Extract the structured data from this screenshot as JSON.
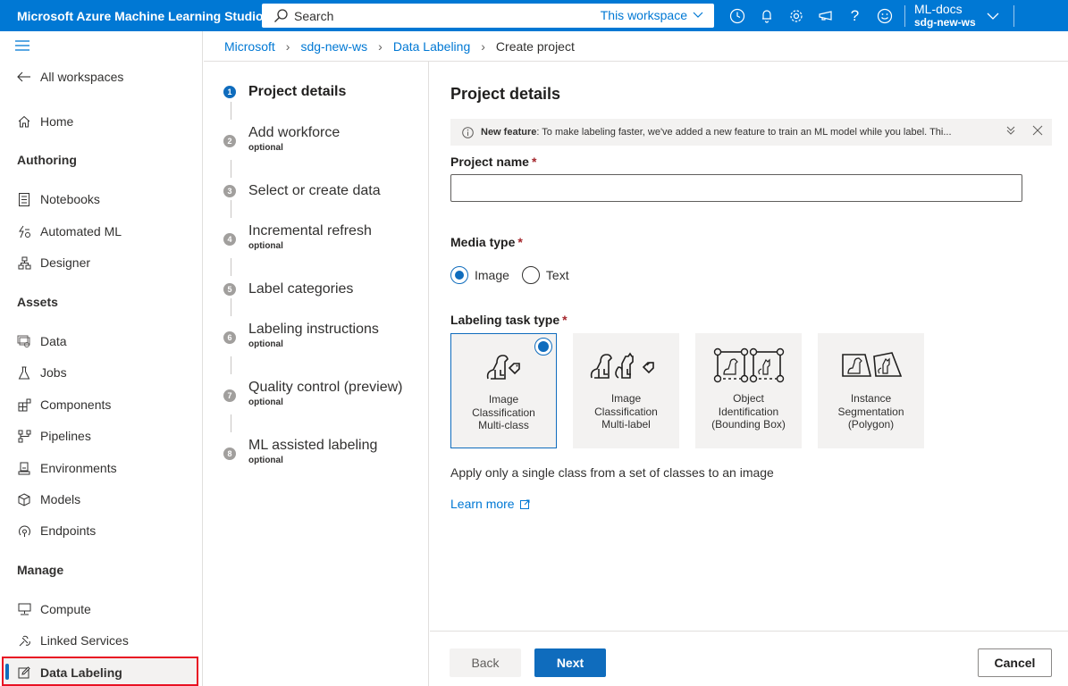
{
  "topbar": {
    "app_title": "Microsoft Azure Machine Learning Studio",
    "search_placeholder": "Search",
    "search_scope": "This workspace",
    "icons": [
      "clock-icon",
      "bell-icon",
      "gear-icon",
      "megaphone-icon",
      "help-icon",
      "smiley-icon"
    ],
    "account": {
      "directory": "ML-docs",
      "workspace": "sdg-new-ws"
    }
  },
  "sidebar": {
    "back_label": "All workspaces",
    "home_label": "Home",
    "sections": [
      {
        "heading": "Authoring",
        "items": [
          "Notebooks",
          "Automated ML",
          "Designer"
        ]
      },
      {
        "heading": "Assets",
        "items": [
          "Data",
          "Jobs",
          "Components",
          "Pipelines",
          "Environments",
          "Models",
          "Endpoints"
        ]
      },
      {
        "heading": "Manage",
        "items": [
          "Compute",
          "Linked Services",
          "Data Labeling"
        ]
      }
    ],
    "active_item": "Data Labeling"
  },
  "breadcrumb": [
    "Microsoft",
    "sdg-new-ws",
    "Data Labeling",
    "Create project"
  ],
  "wizard": {
    "steps": [
      {
        "num": "1",
        "label": "Project details",
        "optional": "",
        "active": true
      },
      {
        "num": "2",
        "label": "Add workforce",
        "optional": "optional"
      },
      {
        "num": "3",
        "label": "Select or create data",
        "optional": ""
      },
      {
        "num": "4",
        "label": "Incremental refresh",
        "optional": "optional"
      },
      {
        "num": "5",
        "label": "Label categories",
        "optional": ""
      },
      {
        "num": "6",
        "label": "Labeling instructions",
        "optional": "optional"
      },
      {
        "num": "7",
        "label": "Quality control (preview)",
        "optional": "optional"
      },
      {
        "num": "8",
        "label": "ML assisted labeling",
        "optional": "optional"
      }
    ]
  },
  "main": {
    "title": "Project details",
    "banner": {
      "bold": "New feature",
      "text": ": To make labeling faster, we've added a new feature to train an ML model while you label. Thi..."
    },
    "project_name_label": "Project name",
    "project_name_value": "",
    "required_marker": "*",
    "media_type_label": "Media type",
    "media_options": [
      {
        "label": "Image",
        "selected": true
      },
      {
        "label": "Text",
        "selected": false
      }
    ],
    "task_type_label": "Labeling task type",
    "task_tiles": [
      {
        "label": "Image Classification Multi-class",
        "lines": [
          "Image",
          "Classification",
          "Multi-class"
        ],
        "selected": true
      },
      {
        "label": "Image Classification Multi-label",
        "lines": [
          "Image",
          "Classification",
          "Multi-label"
        ],
        "selected": false
      },
      {
        "label": "Object Identification (Bounding Box)",
        "lines": [
          "Object",
          "Identification",
          "(Bounding Box)"
        ],
        "selected": false
      },
      {
        "label": "Instance Segmentation (Polygon)",
        "lines": [
          "Instance",
          "Segmentation",
          "(Polygon)"
        ],
        "selected": false
      }
    ],
    "task_description": "Apply only a single class from a set of classes to an image",
    "learn_more": "Learn more"
  },
  "footer": {
    "back": "Back",
    "next": "Next",
    "cancel": "Cancel"
  }
}
